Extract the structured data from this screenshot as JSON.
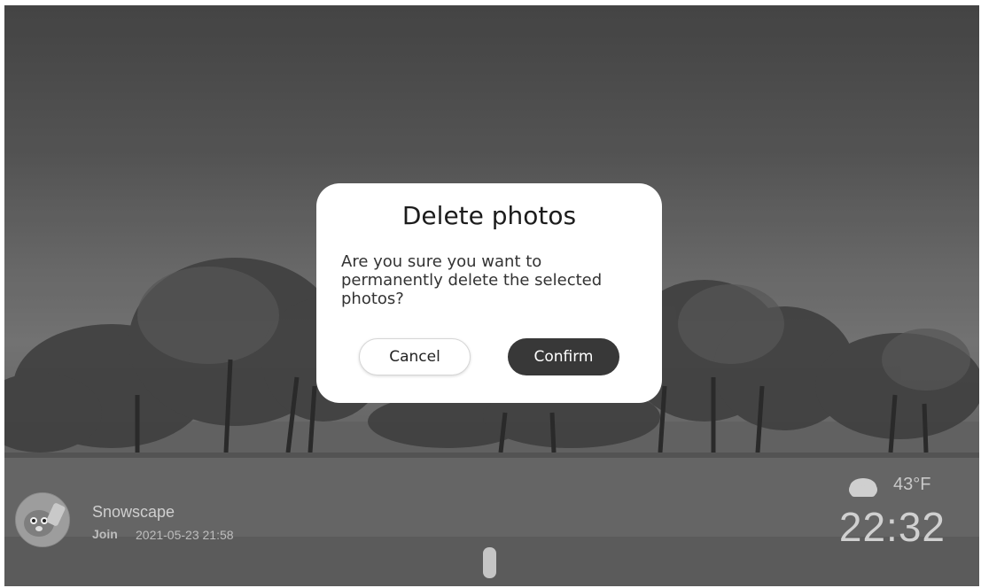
{
  "dialog": {
    "title": "Delete photos",
    "message": "Are you sure you want to permanently delete the selected photos?",
    "cancel_label": "Cancel",
    "confirm_label": "Confirm"
  },
  "album": {
    "name": "Snowscape",
    "join_label": "Join",
    "join_date": "2021-05-23 21:58"
  },
  "status": {
    "weather_icon": "cloud-icon",
    "temperature": "43°F",
    "time": "22:32"
  },
  "colors": {
    "dialog_bg": "#ffffff",
    "confirm_bg": "#383838",
    "text_dark": "#1c1c1c"
  }
}
